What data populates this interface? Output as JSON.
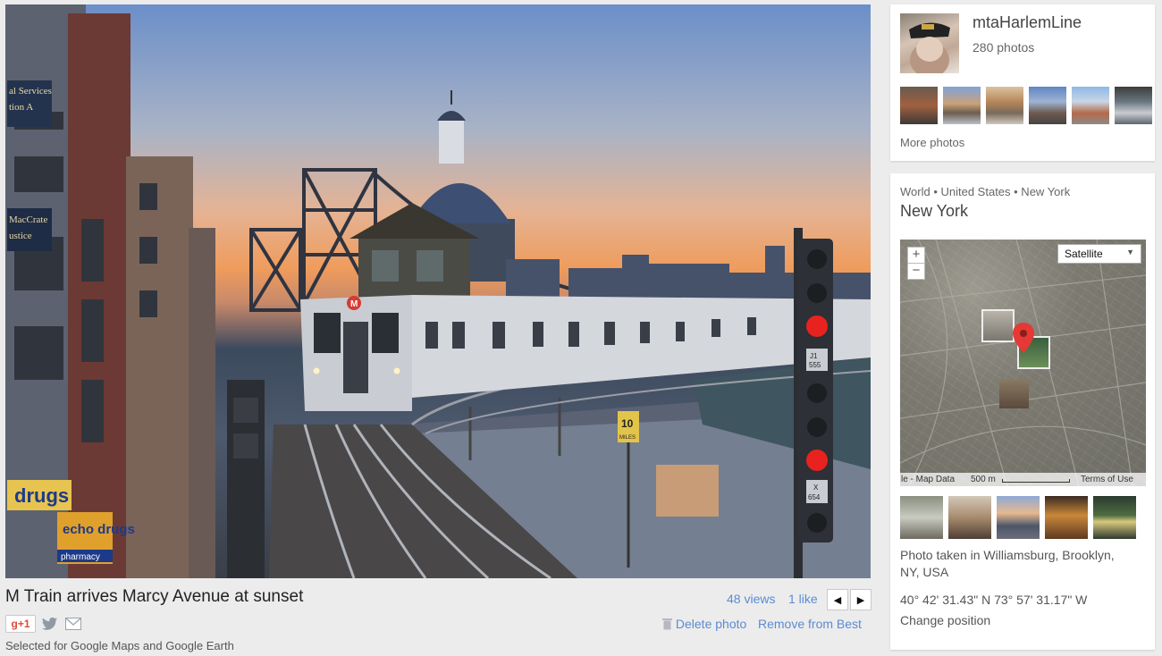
{
  "photo": {
    "title": "M Train arrives Marcy Avenue at sunset",
    "views": "48 views",
    "likes": "1 like",
    "gplus_label": "g+1",
    "selected_note": "Selected for Google Maps and Google Earth",
    "delete_label": "Delete photo",
    "remove_label": "Remove from Best",
    "signs": {
      "services": "al Services",
      "services2": "tion A",
      "macrate": "MacCrate",
      "justice": "ustice",
      "drugs": "drugs",
      "echo": "echo drugs",
      "pharmacy": "pharmacy",
      "train_line": "M",
      "speed_sign": "10",
      "speed_unit": "MILES",
      "signal_j": "J1",
      "signal_num": "555",
      "signal_x": "X",
      "signal_x_num": "654"
    }
  },
  "owner": {
    "name": "mtaHarlemLine",
    "photo_count": "280 photos",
    "more_photos": "More photos"
  },
  "place": {
    "breadcrumb": "World • United States • New York",
    "name": "New York",
    "map_type": "Satellite",
    "zoom_in": "+",
    "zoom_out": "−",
    "map_data": "le - Map Data",
    "scale": "500 m",
    "terms": "Terms of Use",
    "caption": "Photo taken in Williamsburg, Brooklyn, NY, USA",
    "coordinates": "40° 42' 31.43\" N  73° 57' 31.17\" W",
    "change_position": "Change position"
  },
  "colors": {
    "link": "#5c8bd1",
    "map_pin": "#e53935",
    "gplus": "#dd4b39"
  }
}
